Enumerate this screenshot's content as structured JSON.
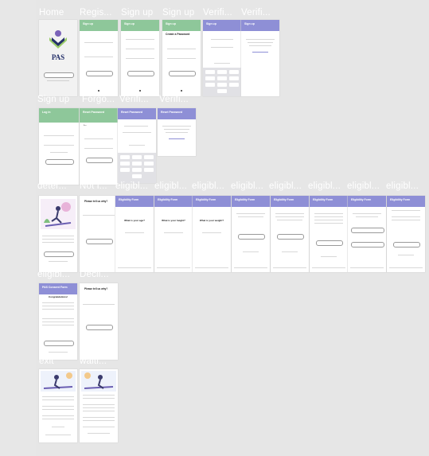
{
  "labels": {
    "row1": [
      "Home",
      "Regis...",
      "Sign up",
      "Sign up",
      "Verifi...",
      "Verifi..."
    ],
    "row2": [
      "Sign up",
      "Forgo...",
      "Verifi...",
      "Verifi..."
    ],
    "row3": [
      "deter...",
      "Not l...",
      "eligibl...",
      "eligibl...",
      "eligibl...",
      "eligibl...",
      "eligibl...",
      "eligibl...",
      "eligibl...",
      "eligibl..."
    ],
    "row4": [
      "eligibl...",
      "Decli..."
    ],
    "row5": [
      "exit",
      "waiti..."
    ]
  },
  "home": {
    "logo_text": "PAS"
  },
  "screens": {
    "signup_header": "Sign up",
    "create_password": "Create a Password",
    "log_in": "Log in",
    "reset_password": "Reset Password",
    "eligibility_form": "Eligibility Form",
    "not_eligible_title": "Please tell us why?",
    "age_q": "What is your age?",
    "height_q": "What is your height?",
    "weight_q": "What is your weight?",
    "consent_header": "PAS Consent Form",
    "congrats": "Congratulations!"
  },
  "colors": {
    "purple_header": "#8e8fd6",
    "green_header": "#8ec79a",
    "logo_purple": "#7a63b8",
    "logo_navy": "#25306a",
    "logo_green": "#9ccd6b"
  }
}
